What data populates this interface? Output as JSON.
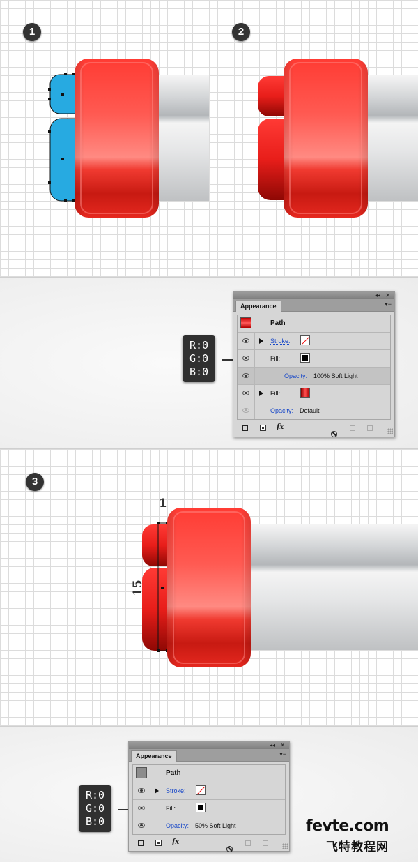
{
  "steps": {
    "s1": "1",
    "s2": "2",
    "s3": "3"
  },
  "colors": {
    "fill_blue": "#27aae1",
    "red_accent": "#e8231f",
    "panel_bg": "#d6d6d6"
  },
  "panel1": {
    "tab": "Appearance",
    "path_label": "Path",
    "stroke_label": "Stroke:",
    "fill_label": "Fill:",
    "opacity_label": "Opacity:",
    "opacity_value": "100% Soft Light",
    "fill2_label": "Fill:",
    "opacity2_label": "Opacity:",
    "opacity2_value": "Default",
    "fx_label": "fx",
    "collapse_icon": "◂◂",
    "close_icon": "✕",
    "menu_icon": "▾≡"
  },
  "panel2": {
    "tab": "Appearance",
    "path_label": "Path",
    "stroke_label": "Stroke:",
    "fill_label": "Fill:",
    "opacity_label": "Opacity:",
    "opacity_value": "50% Soft Light",
    "fx_label": "fx",
    "collapse_icon": "◂◂",
    "close_icon": "✕",
    "menu_icon": "▾≡"
  },
  "rgb1": {
    "r": "R:0",
    "g": "G:0",
    "b": "B:0"
  },
  "rgb2": {
    "r": "R:0",
    "g": "G:0",
    "b": "B:0"
  },
  "dimensions": {
    "width": "1",
    "height": "15"
  },
  "watermark": {
    "site": "fevte.com",
    "chinese": "飞特教程网"
  }
}
